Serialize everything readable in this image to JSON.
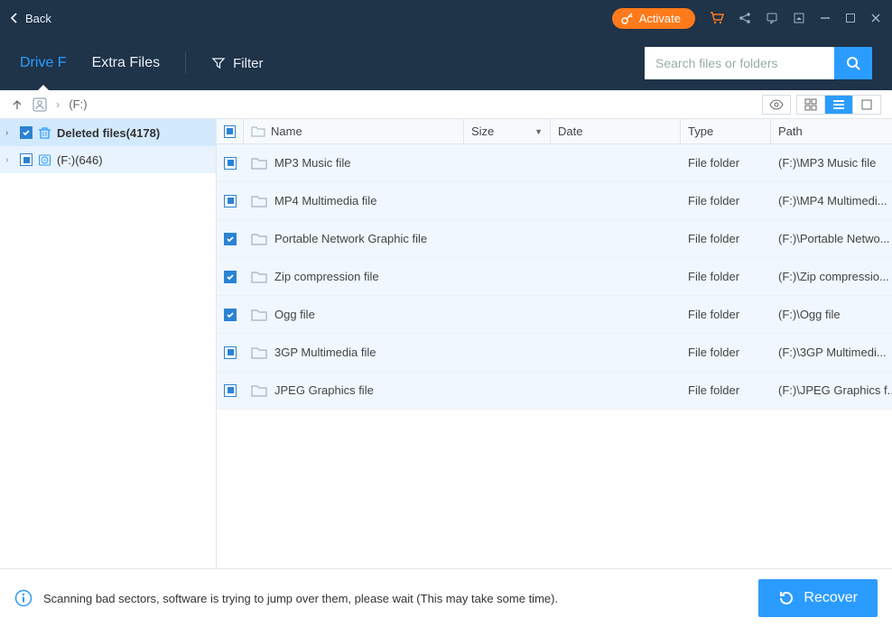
{
  "titlebar": {
    "back_label": "Back",
    "activate_label": "Activate"
  },
  "nav": {
    "tab_drive": "Drive F",
    "tab_extra": "Extra Files",
    "filter_label": "Filter"
  },
  "search": {
    "placeholder": "Search files or folders"
  },
  "breadcrumb": {
    "path": "(F:)"
  },
  "sidebar": {
    "items": [
      {
        "label": "Deleted files(4178)",
        "icon": "trash",
        "checked": "checked",
        "selected": true
      },
      {
        "label": "(F:)(646)",
        "icon": "disk",
        "checked": "indet",
        "selected": false
      }
    ]
  },
  "table": {
    "headers": {
      "name": "Name",
      "size": "Size",
      "date": "Date",
      "type": "Type",
      "path": "Path"
    },
    "rows": [
      {
        "name": "MP3 Music file",
        "type": "File folder",
        "path": "(F:)\\MP3 Music file",
        "checked": "indet"
      },
      {
        "name": "MP4 Multimedia file",
        "type": "File folder",
        "path": "(F:)\\MP4 Multimedi...",
        "checked": "indet"
      },
      {
        "name": "Portable Network Graphic file",
        "type": "File folder",
        "path": "(F:)\\Portable Netwo...",
        "checked": "checked"
      },
      {
        "name": "Zip compression file",
        "type": "File folder",
        "path": "(F:)\\Zip compressio...",
        "checked": "checked"
      },
      {
        "name": "Ogg file",
        "type": "File folder",
        "path": "(F:)\\Ogg file",
        "checked": "checked"
      },
      {
        "name": "3GP Multimedia file",
        "type": "File folder",
        "path": "(F:)\\3GP Multimedi...",
        "checked": "indet"
      },
      {
        "name": "JPEG Graphics file",
        "type": "File folder",
        "path": "(F:)\\JPEG Graphics f...",
        "checked": "indet"
      }
    ]
  },
  "footer": {
    "status": "Scanning bad sectors, software is trying to jump over them, please wait (This may take some time).",
    "recover_label": "Recover"
  }
}
